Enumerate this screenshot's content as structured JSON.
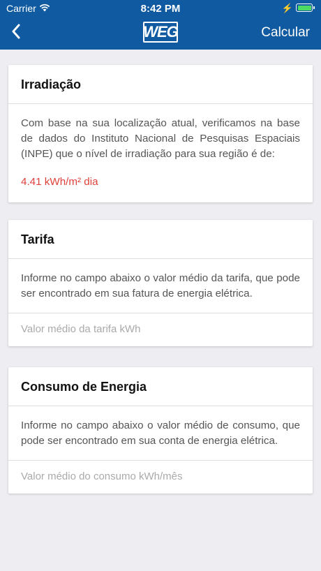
{
  "status_bar": {
    "carrier": "Carrier",
    "time": "8:42 PM",
    "battery_level": 1.0,
    "charging": true
  },
  "nav": {
    "back_icon": "chevron-left-icon",
    "logo": "WEG",
    "action_label": "Calcular"
  },
  "irradiacao": {
    "title": "Irradiação",
    "body": "Com base na sua localização atual, verificamos na base de dados do Instituto Nacional de Pesquisas Espaciais (INPE) que o nível de irradiação para sua região é de:",
    "value": "4.41 kWh/m² dia"
  },
  "tarifa": {
    "title": "Tarifa",
    "body": "Informe no campo abaixo o valor médio da tarifa, que pode ser encontrado em sua fatura de energia elétrica.",
    "placeholder": "Valor médio da tarifa kWh",
    "value": ""
  },
  "consumo": {
    "title": "Consumo de Energia",
    "body": "Informe no campo abaixo o valor médio de consumo, que pode ser encontrado em sua conta de energia elétrica.",
    "placeholder": "Valor médio do consumo kWh/mês",
    "value": ""
  },
  "colors": {
    "nav_background": "#0f5aa0",
    "accent_value": "#e0403a",
    "page_background": "#eeeef2"
  }
}
